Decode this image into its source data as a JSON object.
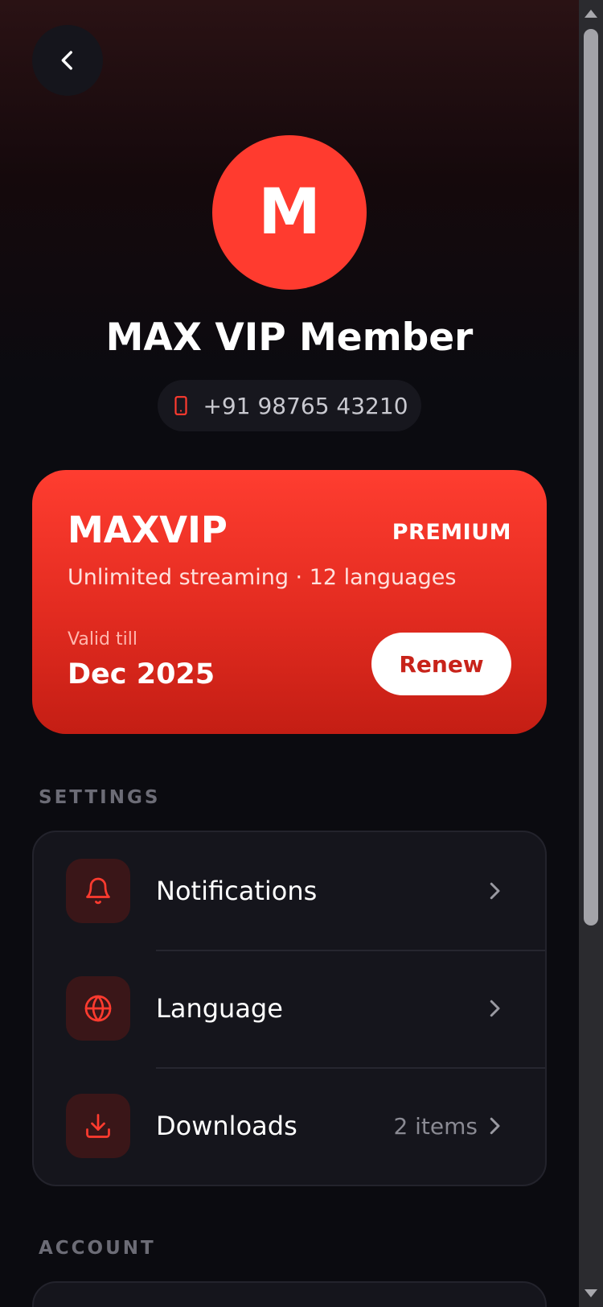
{
  "colors": {
    "accent": "#ff3b2f",
    "background": "#0b0b10",
    "card": "#15151c"
  },
  "header": {
    "back_icon": "chevron-left-icon"
  },
  "profile": {
    "avatar_initial": "M",
    "name": "MAX VIP Member",
    "phone_icon": "smartphone-icon",
    "phone": "+91 98765 43210"
  },
  "plan": {
    "name": "MAXVIP",
    "tier": "PREMIUM",
    "description": "Unlimited streaming · 12 languages",
    "valid_label": "Valid till",
    "valid_date": "Dec 2025",
    "renew_label": "Renew"
  },
  "settings": {
    "title": "SETTINGS",
    "items": [
      {
        "label": "Notifications",
        "icon": "bell-icon",
        "value": ""
      },
      {
        "label": "Language",
        "icon": "globe-icon",
        "value": ""
      },
      {
        "label": "Downloads",
        "icon": "download-icon",
        "value": "2 items"
      }
    ]
  },
  "account": {
    "title": "ACCOUNT"
  }
}
